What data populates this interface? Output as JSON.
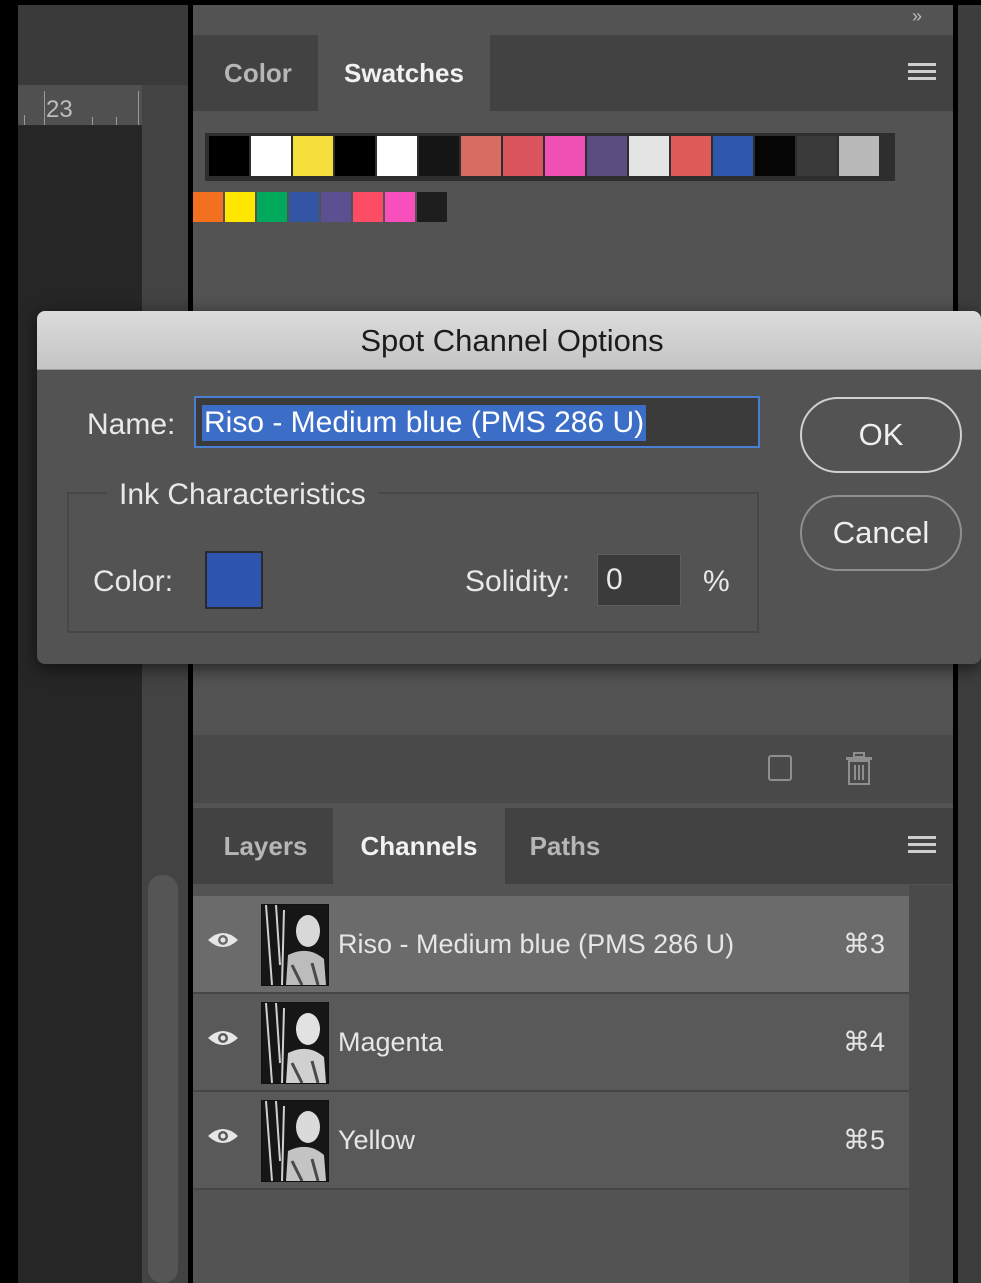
{
  "ruler": {
    "label": "23"
  },
  "swatches_panel": {
    "tabs": [
      {
        "label": "Color",
        "active": false
      },
      {
        "label": "Swatches",
        "active": true
      }
    ],
    "menu_icon": "panel-menu-icon",
    "collapse_icon": "»",
    "row1_colors": [
      "#000000",
      "#ffffff",
      "#f6df3c",
      "#000000",
      "#ffffff",
      "#151515",
      "#d86c62",
      "#d9545d",
      "#f050b5",
      "#5b4d82",
      "#e4e4e4",
      "#df5b58",
      "#2f57ad",
      "#050505",
      "#3a3a3a",
      "#b9b9b9"
    ],
    "row2_colors": [
      "#f37021",
      "#ffe600",
      "#00a95c",
      "#3255a4",
      "#5d5092",
      "#ff4c65",
      "#f84fbc",
      "#1e1e1e"
    ],
    "footer_icons": [
      "new-swatch-icon",
      "trash-icon"
    ]
  },
  "dialog": {
    "title": "Spot Channel Options",
    "name_label": "Name:",
    "name_value": "Riso - Medium blue (PMS 286 U)",
    "group_label": "Ink Characteristics",
    "color_label": "Color:",
    "ink_color": "#2d55b0",
    "solidity_label": "Solidity:",
    "solidity_value": "0",
    "percent_label": "%",
    "ok_label": "OK",
    "cancel_label": "Cancel"
  },
  "channels_panel": {
    "tabs": [
      {
        "label": "Layers",
        "active": false
      },
      {
        "label": "Channels",
        "active": true
      },
      {
        "label": "Paths",
        "active": false
      }
    ],
    "rows": [
      {
        "name": "Riso - Medium blue (PMS 286 U)",
        "shortcut": "⌘3",
        "selected": true
      },
      {
        "name": "Magenta",
        "shortcut": "⌘4",
        "selected": false
      },
      {
        "name": "Yellow",
        "shortcut": "⌘5",
        "selected": false
      }
    ]
  }
}
